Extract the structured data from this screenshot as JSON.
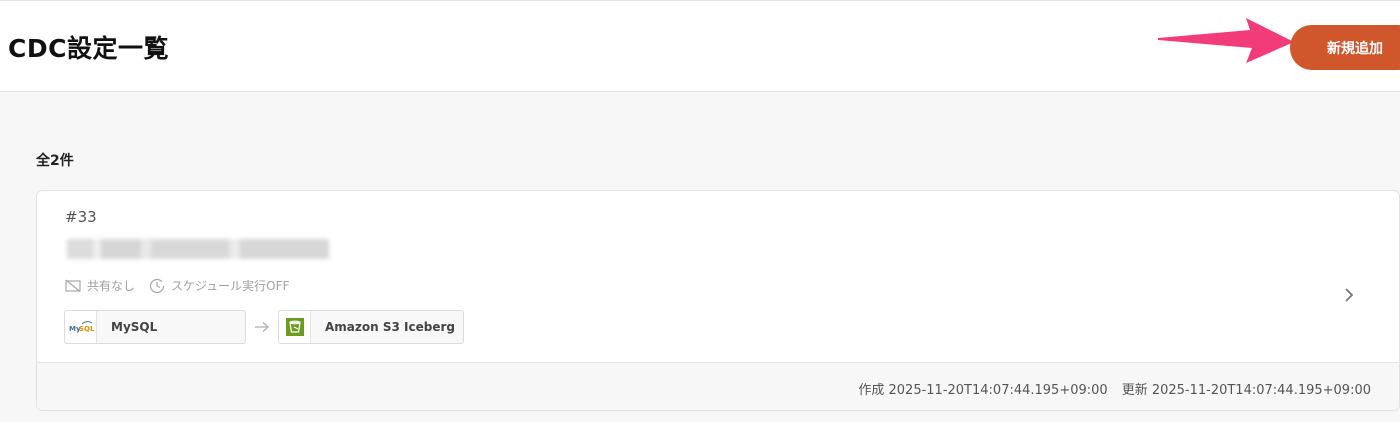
{
  "header": {
    "title": "CDC設定一覧",
    "add_button_label": "新規追加"
  },
  "list": {
    "count_label": "全2件"
  },
  "card": {
    "id_label": "#33",
    "sharing_label": "共有なし",
    "schedule_label": "スケジュール実行OFF",
    "source": {
      "name": "MySQL",
      "icon": "mysql-logo-icon"
    },
    "destination": {
      "name": "Amazon S3 Iceberg",
      "icon": "s3-bucket-icon"
    },
    "created_label": "作成 2025-11-20T14:07:44.195+09:00",
    "updated_label": "更新 2025-11-20T14:07:44.195+09:00"
  },
  "colors": {
    "accent": "#d0562b",
    "annotation_arrow": "#f23c7a",
    "s3_green": "#6b9b23"
  }
}
